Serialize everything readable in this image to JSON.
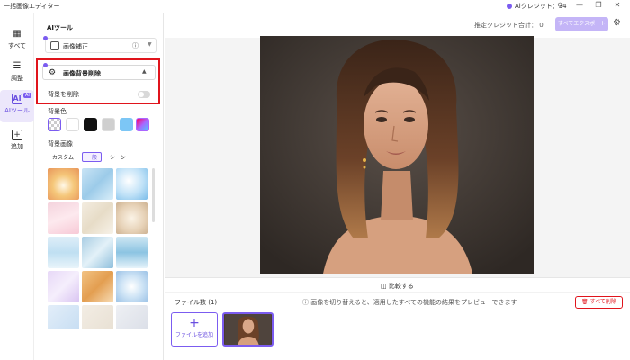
{
  "window": {
    "title": "一括画像エディター",
    "credit_label": "Aiクレジット：34",
    "controls": [
      "refresh-icon",
      "minimize-icon",
      "restore-icon",
      "close-icon"
    ]
  },
  "leftnav": {
    "items": [
      {
        "label": "すべて",
        "icon": "grid-icon"
      },
      {
        "label": "調整",
        "icon": "sliders-icon"
      },
      {
        "label": "AIツール",
        "icon": "ai-icon",
        "badge": "AI"
      },
      {
        "label": "追加",
        "icon": "plus-square-icon"
      }
    ],
    "active": "AIツール"
  },
  "panel": {
    "title": "AIツール",
    "enhance_label": "画像補正",
    "bg_remove_label": "画像背景削除",
    "remove_bg_toggle_label": "背景を削除",
    "bg_color_label": "背景色",
    "bg_image_label": "背景画像",
    "tabs": [
      "カスタム",
      "一般",
      "シーン"
    ],
    "active_tab": "一般"
  },
  "main": {
    "used_credits": "推定クレジット合計：  0",
    "export_label": "すべてエクスポート",
    "compare_label": "比較する",
    "file_count": "ファイル数 (1)",
    "hint": "画像を切り替えると、適用したすべての機能の結果をプレビューできます",
    "delete_all": "すべて削除",
    "add_file": "ファイルを追加"
  },
  "colors": {
    "accent": "#7b5cf0",
    "highlight_red": "#e0141c"
  }
}
